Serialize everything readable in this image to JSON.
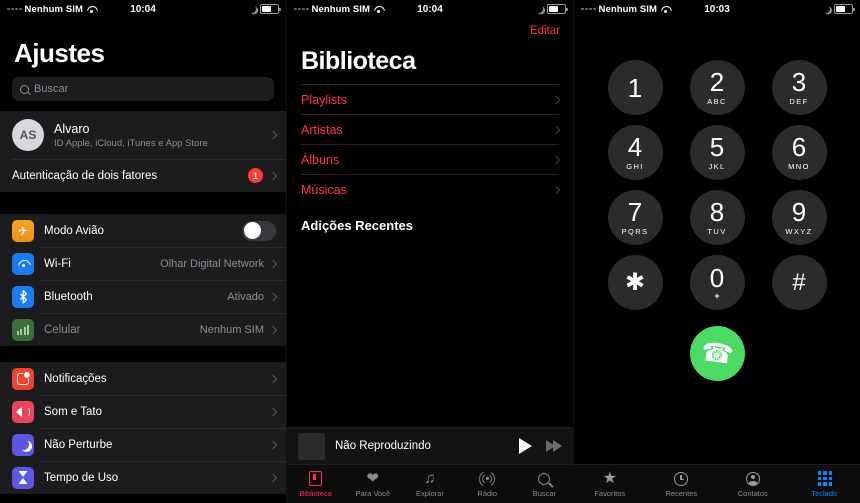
{
  "settings": {
    "status": {
      "carrier": "Nenhum SIM",
      "time": "10:04"
    },
    "title": "Ajustes",
    "search": {
      "placeholder": "Buscar"
    },
    "account": {
      "initials": "AS",
      "name": "Alvaro",
      "subtitle": "ID Apple, iCloud, iTunes e App Store"
    },
    "two_factor": {
      "label": "Autenticação de dois fatores",
      "badge": "1"
    },
    "group1": [
      {
        "label": "Modo Avião",
        "icon": "airplane-icon",
        "value": "",
        "control": "toggle",
        "toggle_on": false
      },
      {
        "label": "Wi-Fi",
        "icon": "wifi-icon",
        "value": "Olhar Digital Network",
        "control": "chevron"
      },
      {
        "label": "Bluetooth",
        "icon": "bluetooth-icon",
        "value": "Ativado",
        "control": "chevron"
      },
      {
        "label": "Celular",
        "icon": "cellular-icon",
        "value": "Nenhum SIM",
        "control": "chevron",
        "dim": true
      }
    ],
    "group2": [
      {
        "label": "Notificações",
        "icon": "notifications-icon",
        "value": "",
        "control": "chevron"
      },
      {
        "label": "Som e Tato",
        "icon": "sound-icon",
        "value": "",
        "control": "chevron"
      },
      {
        "label": "Não Perturbe",
        "icon": "do-not-disturb-icon",
        "value": "",
        "control": "chevron"
      },
      {
        "label": "Tempo de Uso",
        "icon": "screen-time-icon",
        "value": "",
        "control": "chevron"
      }
    ]
  },
  "music": {
    "status": {
      "carrier": "Nenhum SIM",
      "time": "10:04"
    },
    "edit_label": "Editar",
    "title": "Biblioteca",
    "accent": "#fc3158",
    "rows": [
      {
        "label": "Playlists"
      },
      {
        "label": "Artistas"
      },
      {
        "label": "Álbuns"
      },
      {
        "label": "Músicas"
      }
    ],
    "section_header": "Adições Recentes",
    "miniplayer": {
      "title": "Não Reproduzindo"
    },
    "tabs": [
      {
        "label": "Biblioteca",
        "icon": "library-icon",
        "active": true
      },
      {
        "label": "Para Você",
        "icon": "heart-icon",
        "active": false
      },
      {
        "label": "Explorar",
        "icon": "music-note-icon",
        "active": false
      },
      {
        "label": "Rádio",
        "icon": "radio-icon",
        "active": false
      },
      {
        "label": "Buscar",
        "icon": "search-icon",
        "active": false
      }
    ]
  },
  "phone": {
    "status": {
      "carrier": "Nenhum SIM",
      "time": "10:03"
    },
    "accent": "#0a84ff",
    "call_color": "#4cd964",
    "keys": [
      {
        "digit": "1",
        "letters": ""
      },
      {
        "digit": "2",
        "letters": "ABC"
      },
      {
        "digit": "3",
        "letters": "DEF"
      },
      {
        "digit": "4",
        "letters": "GHI"
      },
      {
        "digit": "5",
        "letters": "JKL"
      },
      {
        "digit": "6",
        "letters": "MNO"
      },
      {
        "digit": "7",
        "letters": "PQRS"
      },
      {
        "digit": "8",
        "letters": "TUV"
      },
      {
        "digit": "9",
        "letters": "WXYZ"
      },
      {
        "digit": "✱",
        "letters": ""
      },
      {
        "digit": "0",
        "letters": "+"
      },
      {
        "digit": "#",
        "letters": ""
      }
    ],
    "call_button": "call-icon",
    "tabs": [
      {
        "label": "Favoritos",
        "icon": "star-icon",
        "active": false
      },
      {
        "label": "Recentes",
        "icon": "clock-icon",
        "active": false
      },
      {
        "label": "Contatos",
        "icon": "contact-icon",
        "active": false
      },
      {
        "label": "Teclado",
        "icon": "keypad-icon",
        "active": true
      }
    ]
  }
}
